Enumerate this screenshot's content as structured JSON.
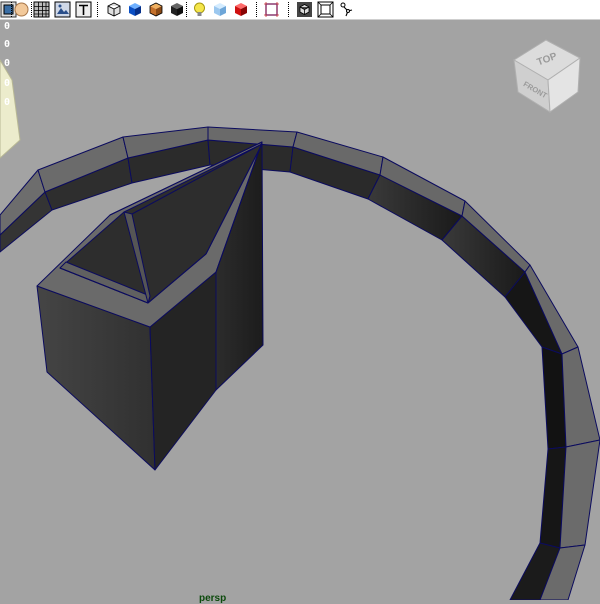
{
  "toolbar": {
    "tools": [
      "select-icon",
      "sphere-icon",
      "grid-icon",
      "image-plane-icon",
      "text-icon",
      "wire-cube-icon",
      "blue-cube-icon",
      "textured-cube-icon",
      "dark-cube-icon",
      "light-bulb-icon",
      "light-blue-cube-icon",
      "red-cube-icon",
      "region-select-icon",
      "isolate-cube-icon",
      "frame-icon",
      "skeleton-icon"
    ]
  },
  "hud": {
    "values": [
      "0",
      "0",
      "0",
      "0",
      "0"
    ]
  },
  "viewcube": {
    "top_label": "TOP",
    "front_label": "FRONT"
  },
  "camera_label": "persp",
  "colors": {
    "viewport_bg": "#a3a3a3",
    "mesh_top": "#6b6b6b",
    "mesh_side": "#2e2e2e",
    "wire_edge": "#0b0b5e",
    "camera_label": "#0c4a0c"
  }
}
